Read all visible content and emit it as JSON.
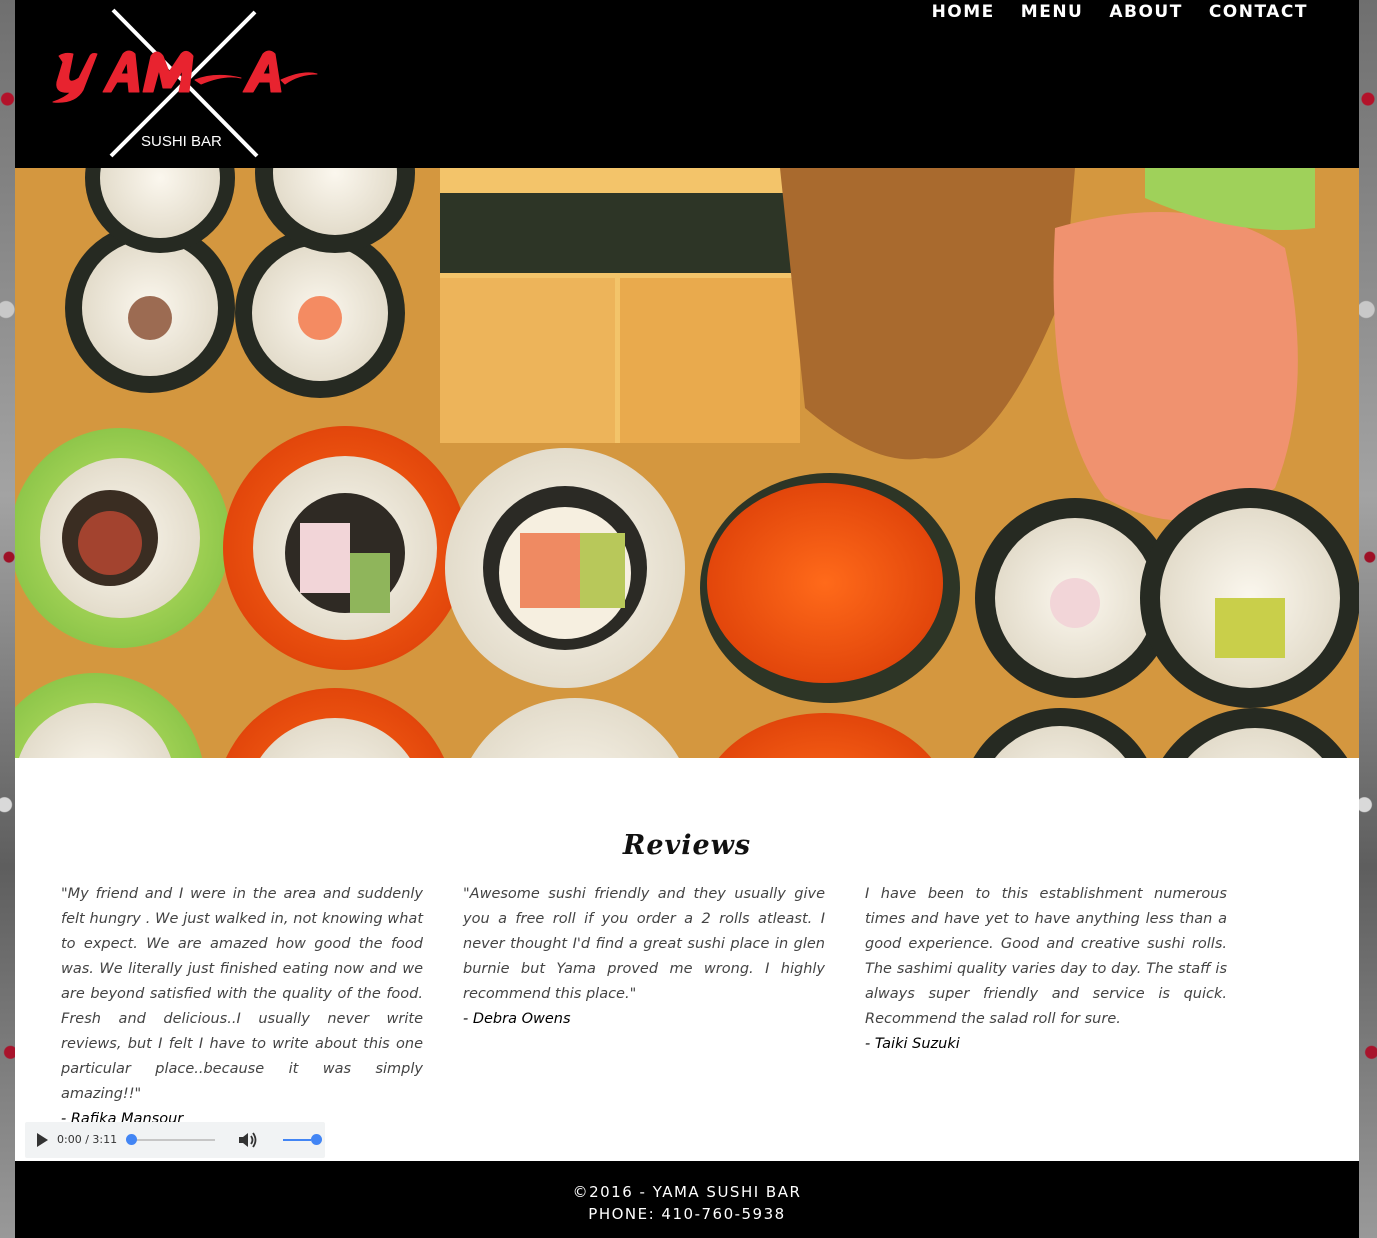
{
  "brand": {
    "logo_text": "YAMA",
    "logo_subtext": "SUSHI BAR",
    "accent_color": "#e8232f"
  },
  "nav": {
    "items": [
      {
        "label": "HOME"
      },
      {
        "label": "MENU"
      },
      {
        "label": "ABOUT"
      },
      {
        "label": "CONTACT"
      }
    ]
  },
  "hero": {
    "image_subject": "sushi rolls platter"
  },
  "reviews": {
    "title": "Reviews",
    "items": [
      {
        "text": "\"My friend and I were in the area and suddenly felt hungry . We just walked in, not knowing what to expect. We are amazed how good the food was. We literally just finished eating now and we are beyond satisfied with the quality of the food. Fresh and delicious..I usually never write reviews, but I felt I have to write about this one particular place..because it was simply amazing!!\"",
        "author": "- Rafika Mansour"
      },
      {
        "text": "\"Awesome sushi friendly and they usually give you a free roll if you order a 2 rolls atleast. I never thought I'd find a great sushi place in glen burnie but Yama proved me wrong. I highly recommend this place.\"",
        "author": "- Debra Owens"
      },
      {
        "text": "I have been to this establishment numerous times and have yet to have anything less than a good experience. Good and creative sushi rolls. The sashimi quality varies day to day. The staff is always super friendly and service is quick. Recommend the salad roll for sure.",
        "author": "- Taiki Suzuki"
      }
    ]
  },
  "audio_player": {
    "time": "0:00 / 3:11",
    "progress": 0,
    "volume": 1.0,
    "accent": "#4285f4"
  },
  "footer": {
    "copyright": "©2016 - YAMA SUSHI BAR",
    "phone": "PHONE: 410-760-5938"
  }
}
